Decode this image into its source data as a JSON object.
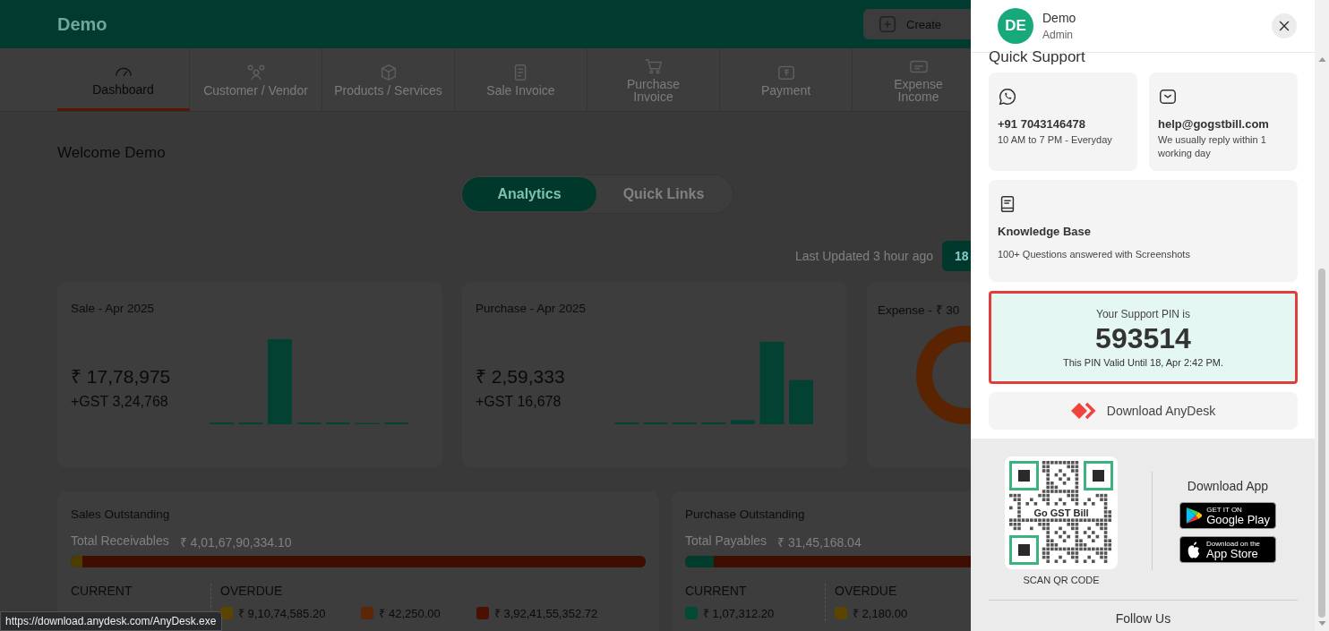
{
  "app": {
    "title": "Demo",
    "create_button": "Create"
  },
  "nav": [
    {
      "label": "Dashboard",
      "selected": true
    },
    {
      "label": "Customer / Vendor",
      "selected": false
    },
    {
      "label": "Products / Services",
      "selected": false
    },
    {
      "label": "Sale Invoice",
      "selected": false
    },
    {
      "label": "Purchase Invoice",
      "selected": false
    },
    {
      "label": "Payment",
      "selected": false
    },
    {
      "label": "Expense Income",
      "selected": false
    }
  ],
  "welcome": "Welcome Demo",
  "view_toggle": [
    {
      "label": "Analytics",
      "selected": true
    },
    {
      "label": "Quick Links",
      "selected": false
    }
  ],
  "last_updated": "Last Updated 3 hour ago",
  "refresh_button": "18",
  "summary_cards": [
    {
      "kind": "bars",
      "title": "Sale - Apr 2025",
      "amount": "₹ 17,78,975",
      "gst": "+GST 3,24,768"
    },
    {
      "kind": "bars",
      "title": "Purchase - Apr 2025",
      "amount": "₹ 2,59,333",
      "gst": "+GST 16,678"
    },
    {
      "kind": "donut",
      "title": "Expense - ₹ 30"
    }
  ],
  "outstanding": [
    {
      "title": "Sales Outstanding",
      "total_label": "Total Receivables",
      "total": "₹ 4,01,67,90,334.10",
      "bar": {
        "color": "#4e3c00",
        "level": 0.02
      },
      "current_header": "CURRENT",
      "overdue_header": "OVERDUE",
      "overdue": [
        {
          "color": "#5a4400",
          "amount": "₹ 9,10,74,585.20"
        },
        {
          "color": "#5c2608",
          "amount": "₹ 42,250.00"
        },
        {
          "color": "#4c1003",
          "amount": "₹ 3,92,41,55,352.72"
        }
      ]
    },
    {
      "title": "Purchase Outstanding",
      "total_label": "Total Payables",
      "total": "₹ 31,45,168.04",
      "bar": {
        "color": "#013c2c",
        "level": 0.05
      },
      "current_header": "CURRENT",
      "overdue_header": "OVERDUE",
      "current": [
        {
          "color": "#014a36",
          "amount": "₹ 1,07,312.20"
        }
      ],
      "overdue": [
        {
          "color": "#5a4400",
          "amount": "₹ 2,180.00"
        }
      ]
    }
  ],
  "status_url": "https://download.anydesk.com/AnyDesk.exe",
  "drawer": {
    "user": {
      "initials": "DE",
      "name": "Demo",
      "role": "Admin"
    },
    "heading": "Quick Support",
    "contacts": [
      {
        "kind": "whatsapp",
        "title": "+91 7043146478",
        "note": "10 AM to 7 PM - Everyday"
      },
      {
        "kind": "email",
        "title": "help@gogstbill.com",
        "note": "We usually reply within 1 working day"
      },
      {
        "kind": "book",
        "title": "Knowledge Base",
        "note": "100+ Questions answered with Screenshots"
      }
    ],
    "pin": {
      "label": "Your Support PIN is",
      "value": "593514",
      "validity": "This PIN Valid Until 18, Apr 2:42 PM."
    },
    "anydesk_button": "Download AnyDesk",
    "qr": {
      "logo_text": "Go GST Bill",
      "caption": "SCAN QR CODE"
    },
    "download_app": {
      "title": "Download App",
      "stores": [
        {
          "kind": "google",
          "small": "GET IT ON",
          "big": "Google Play"
        },
        {
          "kind": "apple",
          "small": "Download on the",
          "big": "App Store"
        }
      ]
    },
    "follow_us": "Follow Us"
  }
}
